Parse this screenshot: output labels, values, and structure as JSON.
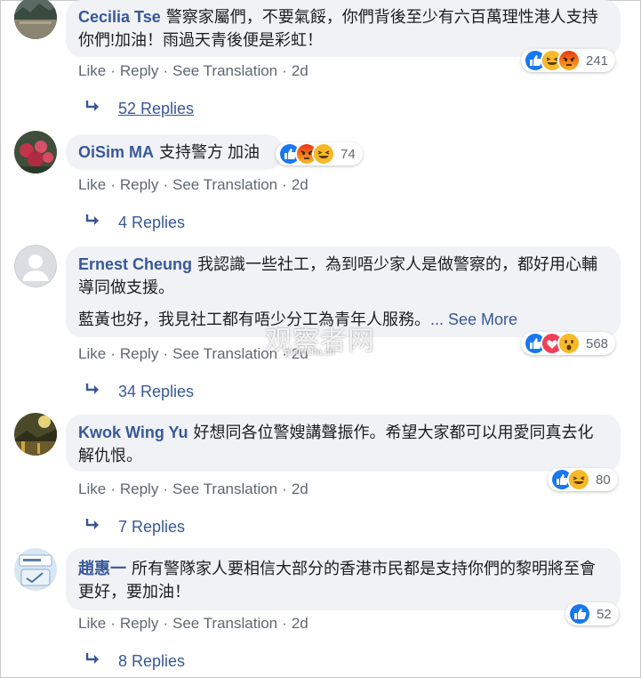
{
  "colors": {
    "link": "#385898",
    "meta": "#606770",
    "bubble": "#f0f2f5",
    "like_blue": "#1877f2",
    "love_red": "#f33e58",
    "emoji_yellow": "#f7b928",
    "angry_orange": "#e9710f"
  },
  "comments": [
    {
      "author": "Cecilia Tse",
      "text": "警察家屬們，不要氣餒，你們背後至少有六百萬理性港人支持你們!加油！雨過天青後便是彩虹！",
      "actions": {
        "like": "Like",
        "reply": "Reply",
        "translate": "See Translation",
        "time": "2d"
      },
      "reactions": [
        "like",
        "haha",
        "angry"
      ],
      "reaction_count": "241",
      "replies": "52 Replies"
    },
    {
      "author": "OiSim MA",
      "text": "支持警方 加油",
      "actions": {
        "like": "Like",
        "reply": "Reply",
        "translate": "See Translation",
        "time": "2d"
      },
      "reactions": [
        "like",
        "angry",
        "haha"
      ],
      "reaction_count": "74",
      "replies": "4 Replies"
    },
    {
      "author": "Ernest Cheung",
      "text": "我認識一些社工，為到唔少家人是做警察的，都好用心輔導同做支援。",
      "text2": "藍黃也好，我見社工都有唔少分工為青年人服務。",
      "see_more": "... See More",
      "actions": {
        "like": "Like",
        "reply": "Reply",
        "translate": "See Translation",
        "time": "2d"
      },
      "reactions": [
        "like",
        "love",
        "wow"
      ],
      "reaction_count": "568",
      "replies": "34 Replies"
    },
    {
      "author": "Kwok Wing Yu",
      "text": "好想同各位警嫂講聲振作。希望大家都可以用愛同真去化解仇恨。",
      "actions": {
        "like": "Like",
        "reply": "Reply",
        "translate": "See Translation",
        "time": "2d"
      },
      "reactions": [
        "like",
        "haha"
      ],
      "reaction_count": "80",
      "replies": "7 Replies"
    },
    {
      "author": "趙惠一",
      "text": "所有警隊家人要相信大部分的香港市民都是支持你們的黎明將至會更好，要加油！",
      "actions": {
        "like": "Like",
        "reply": "Reply",
        "translate": "See Translation",
        "time": "2d"
      },
      "reactions": [
        "like"
      ],
      "reaction_count": "52",
      "replies": "8 Replies"
    }
  ],
  "watermark": {
    "text": "观察者网",
    "url": "guancha.cn"
  }
}
